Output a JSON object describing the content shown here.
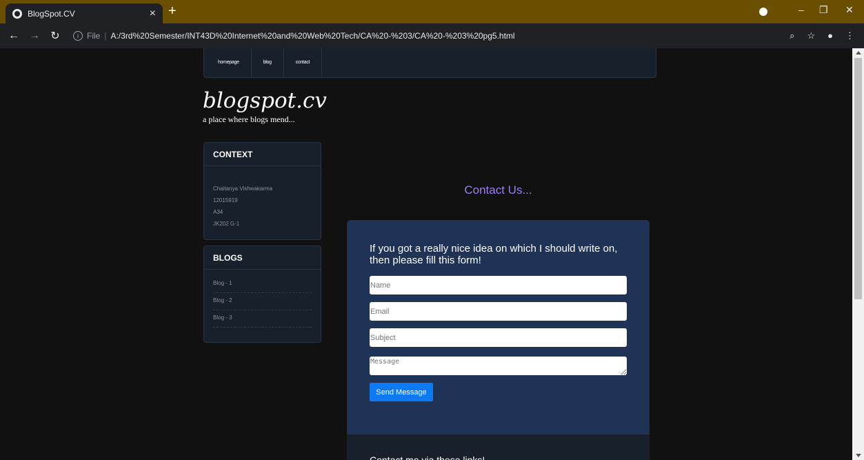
{
  "browser": {
    "tab_title": "BlogSpot.CV",
    "tab_close": "×",
    "new_tab": "+",
    "scheme_label": "File",
    "url": "A:/3rd%20Semester/INT43D%20Internet%20and%20Web%20Tech/CA%20-%203/CA%20-%203%20pg5.html",
    "window": {
      "minimize": "–",
      "restore": "❐",
      "close": "✕"
    }
  },
  "nav": {
    "links": [
      "homepage",
      "blog",
      "contact"
    ]
  },
  "site": {
    "logo": "blogspot.cv",
    "tagline": "a place where blogs mend..."
  },
  "context_panel": {
    "title": "CONTEXT",
    "lines": [
      "Chaitanya Vishwakarma",
      "12015919",
      "A34",
      "JK202 G-1"
    ]
  },
  "blogs_panel": {
    "title": "BLOGS",
    "items": [
      "Blog - 1",
      "Blog - 2",
      "Blog - 3"
    ]
  },
  "contact": {
    "heading": "Contact Us...",
    "lead": "If you got a really nice idea on which I should write on, then please fill this form!",
    "placeholders": {
      "name": "Name",
      "email": "Email",
      "subject": "Subject",
      "message": "Message"
    },
    "send_label": "Send Message"
  },
  "info_card": {
    "text": "Contact me via these links!"
  }
}
